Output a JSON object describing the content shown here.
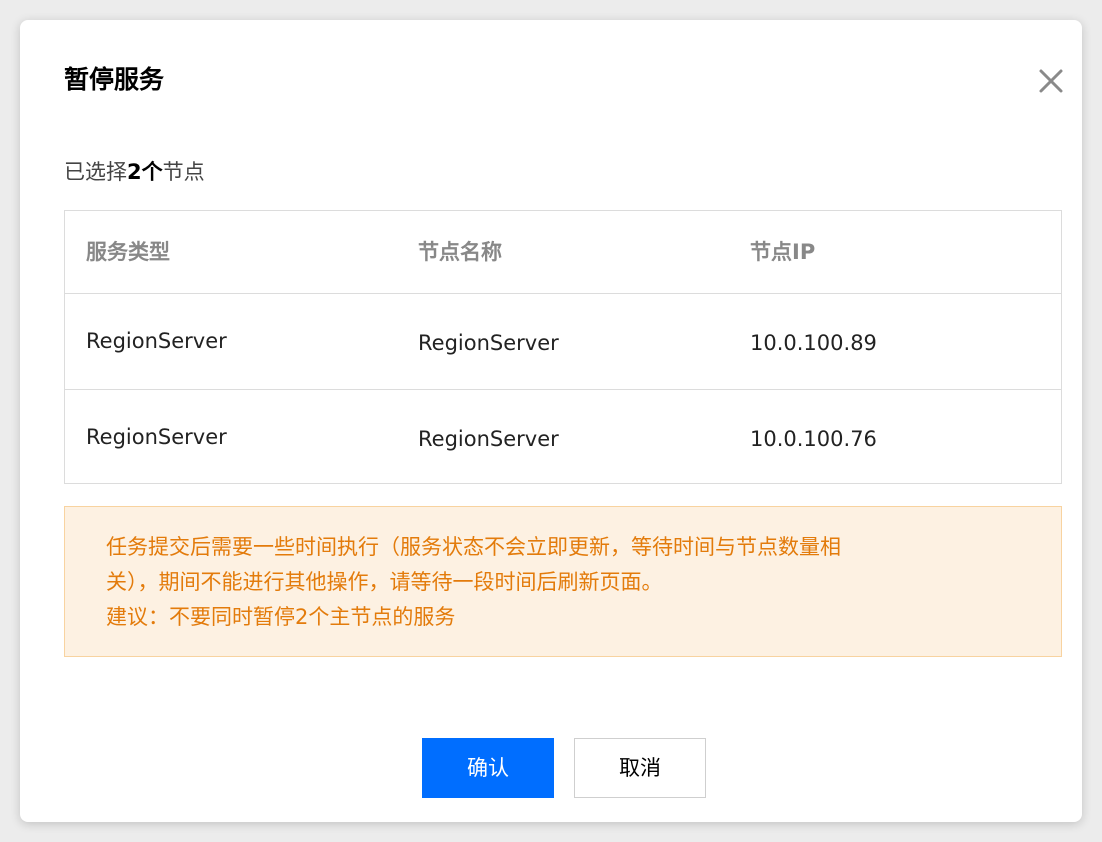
{
  "dialog": {
    "title": "暂停服务",
    "close_icon": "close-icon",
    "selected_prefix": "已选择",
    "selected_count": "2个",
    "selected_suffix": "节点"
  },
  "table": {
    "headers": [
      "服务类型",
      "节点名称",
      "节点IP"
    ],
    "rows": [
      {
        "service_type": "RegionServer",
        "node_name": "RegionServer",
        "node_ip": "10.0.100.89"
      },
      {
        "service_type": "RegionServer",
        "node_name": "RegionServer",
        "node_ip": "10.0.100.76"
      }
    ]
  },
  "notice": {
    "line1": "任务提交后需要一些时间执行（服务状态不会立即更新，等待时间与节点数量相",
    "line2": "关），期间不能进行其他操作，请等待一段时间后刷新页面。",
    "line3": "建议：不要同时暂停2个主节点的服务"
  },
  "footer": {
    "confirm_label": "确认",
    "cancel_label": "取消"
  },
  "colors": {
    "primary": "#006eff",
    "notice_text": "#e37b0b",
    "notice_bg": "#fdf1e2",
    "notice_border": "#f8d3a0"
  }
}
